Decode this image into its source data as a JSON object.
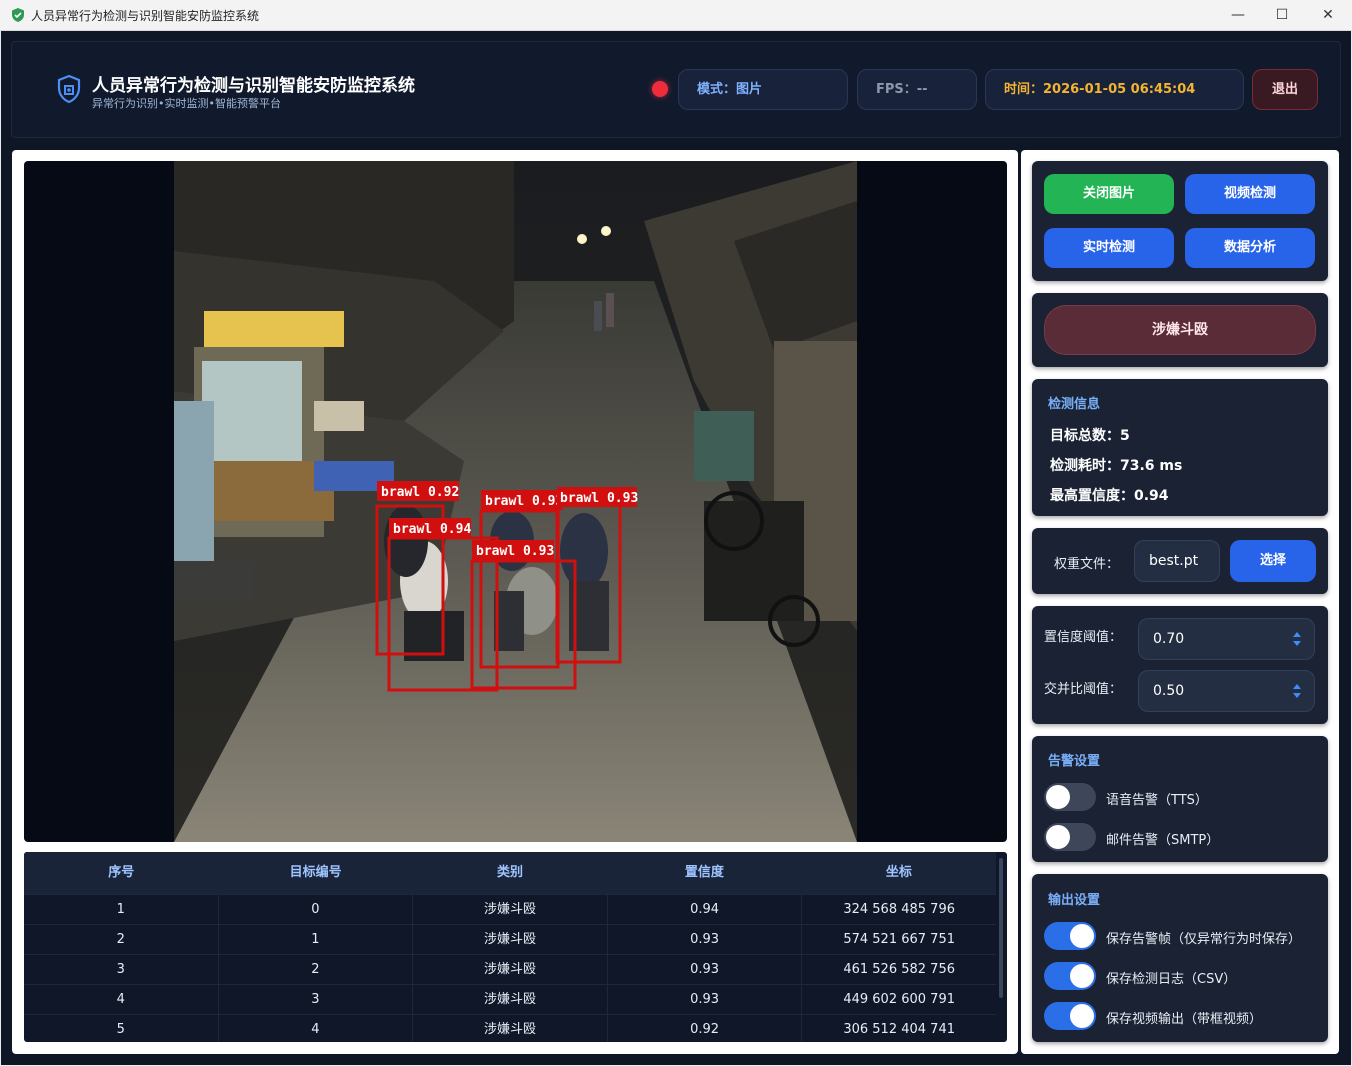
{
  "window": {
    "title": "人员异常行为检测与识别智能安防监控系统"
  },
  "header": {
    "title": "人员异常行为检测与识别智能安防监控系统",
    "subtitle": "异常行为识别•实时监测•智能预警平台",
    "mode": "模式：图片",
    "fps": "FPS：--",
    "time": "时间：2026-01-05 06:45:04",
    "exit_label": "退出",
    "status_color": "#ee2c3c"
  },
  "detections_overlay": [
    {
      "label": "brawl 0.92"
    },
    {
      "label": "brawl 0.94"
    },
    {
      "label": "brawl 0.93"
    },
    {
      "label": "brawl 0.93"
    },
    {
      "label": "brawl 0.93"
    }
  ],
  "table": {
    "headers": [
      "序号",
      "目标编号",
      "类别",
      "置信度",
      "坐标"
    ],
    "rows": [
      [
        "1",
        "0",
        "涉嫌斗殴",
        "0.94",
        "324 568 485 796"
      ],
      [
        "2",
        "1",
        "涉嫌斗殴",
        "0.93",
        "574 521 667 751"
      ],
      [
        "3",
        "2",
        "涉嫌斗殴",
        "0.93",
        "461 526 582 756"
      ],
      [
        "4",
        "3",
        "涉嫌斗殴",
        "0.93",
        "449 602 600 791"
      ],
      [
        "5",
        "4",
        "涉嫌斗殴",
        "0.92",
        "306 512 404 741"
      ]
    ]
  },
  "controls": {
    "close_image": "关闭图片",
    "video_detect": "视频检测",
    "realtime_detect": "实时检测",
    "data_analysis": "数据分析"
  },
  "alert": {
    "label": "涉嫌斗殴"
  },
  "detect_info": {
    "title": "检测信息",
    "total": "目标总数：5",
    "time_cost": "检测耗时：73.6 ms",
    "max_conf": "最高置信度：0.94"
  },
  "weights": {
    "label": "权重文件：",
    "value": "best.pt",
    "select_label": "选择"
  },
  "thresholds": {
    "conf_label": "置信度阈值：",
    "conf_value": "0.70",
    "iou_label": "交并比阈值：",
    "iou_value": "0.50"
  },
  "alarm_settings": {
    "title": "告警设置",
    "tts_label": "语音告警（TTS）",
    "tts_on": false,
    "smtp_label": "邮件告警（SMTP）",
    "smtp_on": false
  },
  "output_settings": {
    "title": "输出设置",
    "save_frames_label": "保存告警帧（仅异常行为时保存）",
    "save_frames_on": true,
    "save_log_label": "保存检测日志（CSV）",
    "save_log_on": true,
    "save_video_label": "保存视频输出（带框视频）",
    "save_video_on": true
  }
}
